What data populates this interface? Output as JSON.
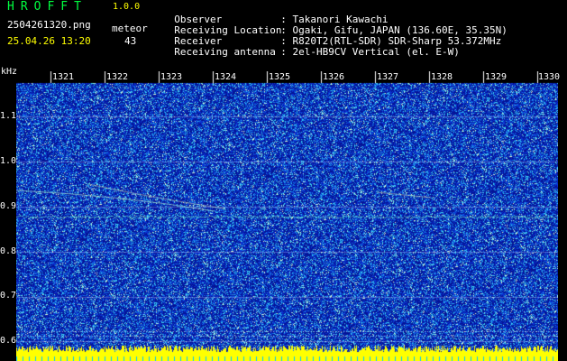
{
  "app": {
    "title": "HROFFT",
    "version": "1.0.0",
    "filename": "2504261320.png",
    "timestamp": "25.04.26 13:20",
    "meteor_label": "meteor",
    "meteor_count": "43"
  },
  "info": [
    {
      "label": "Observer",
      "value": ": Takanori Kawachi"
    },
    {
      "label": "Receiving Location",
      "value": ": Ogaki, Gifu, JAPAN (136.60E, 35.35N)"
    },
    {
      "label": "Receiver",
      "value": ": R820T2(RTL-SDR) SDR-Sharp 53.372MHz"
    },
    {
      "label": "Receiving antenna",
      "value": ": 2el-HB9CV Vertical (el. E-W)"
    }
  ],
  "axes": {
    "y_unit": "kHz",
    "y_ticks": [
      "1.1",
      "1.0",
      "0.9",
      "0.8",
      "0.7",
      "0.6"
    ],
    "x_ticks": [
      "1321",
      "1322",
      "1323",
      "1324",
      "1325",
      "1326",
      "1327",
      "1328",
      "1329",
      "1330"
    ]
  },
  "colors": {
    "background": "#000000",
    "title": "#00ff40",
    "accent": "#ffff00",
    "noise_base": "#0a1fa8"
  }
}
